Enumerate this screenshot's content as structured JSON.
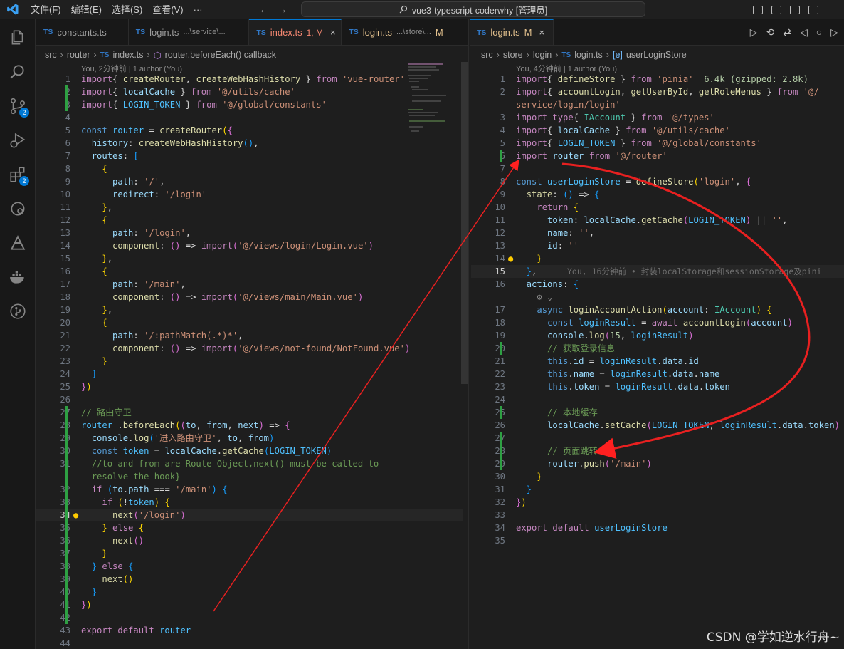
{
  "titlebar": {
    "menu": [
      "文件(F)",
      "编辑(E)",
      "选择(S)",
      "查看(V)",
      "···"
    ],
    "search": "vue3-typescript-coderwhy [管理员]"
  },
  "activity": {
    "icons": [
      "files-icon",
      "search-icon",
      "source-control-icon",
      "run-debug-icon",
      "extensions-icon",
      "remote-explorer-icon",
      "git-graph-icon",
      "docker-icon",
      "git-branch-icon"
    ],
    "badges": {
      "source_control": "2",
      "extensions": "2"
    }
  },
  "left": {
    "tabs": [
      {
        "name": "constants.ts",
        "suffix": "",
        "state": ""
      },
      {
        "name": "login.ts",
        "suffix": "...\\service\\...",
        "state": ""
      },
      {
        "name": "index.ts",
        "suffix": "",
        "state": "1, M"
      },
      {
        "name": "login.ts",
        "suffix": "...\\store\\...",
        "state": "M"
      }
    ],
    "breadcrumb": [
      "src",
      "router",
      "index.ts",
      "router.beforeEach() callback"
    ],
    "blame": "You, 2分钟前 | 1 author (You)"
  },
  "right": {
    "tab": {
      "name": "login.ts",
      "state": "M"
    },
    "breadcrumb": [
      "src",
      "store",
      "login",
      "login.ts",
      "userLoginStore"
    ],
    "blame": "You, 4分钟前 | 1 author (You)",
    "inline_blame": "You, 16分钟前 • 封装localStorage和sessionStorage及pini"
  },
  "watermark": "CSDN @学如逆水行舟~"
}
